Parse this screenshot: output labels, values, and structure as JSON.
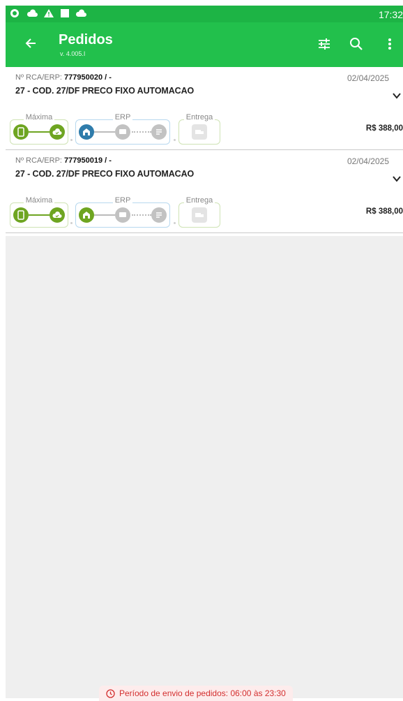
{
  "status_bar": {
    "time": "17:32"
  },
  "app_bar": {
    "title": "Pedidos",
    "version": "v. 4.005.I"
  },
  "orders": [
    {
      "rca_label": "Nº RCA/ERP:",
      "rca_value": "777950020 / -",
      "date": "02/04/2025",
      "client": "27 - COD. 27/DF PRECO FIXO AUTOMACAO",
      "value": "R$ 388,00",
      "stages": {
        "maxima": "Máxima",
        "erp": "ERP",
        "entrega": "Entrega"
      }
    },
    {
      "rca_label": "Nº RCA/ERP:",
      "rca_value": "777950019 / -",
      "date": "02/04/2025",
      "client": "27 - COD. 27/DF PRECO FIXO AUTOMACAO",
      "value": "R$ 388,00",
      "stages": {
        "maxima": "Máxima",
        "erp": "ERP",
        "entrega": "Entrega"
      }
    }
  ],
  "footer": {
    "text": "Período de envio de pedidos: 06:00 às 23:30"
  },
  "colors": {
    "primary": "#22c04c",
    "status": "#1db445",
    "stage_green": "#6ea521",
    "stage_blue": "#2f7cab",
    "warning": "#d32f2f"
  }
}
